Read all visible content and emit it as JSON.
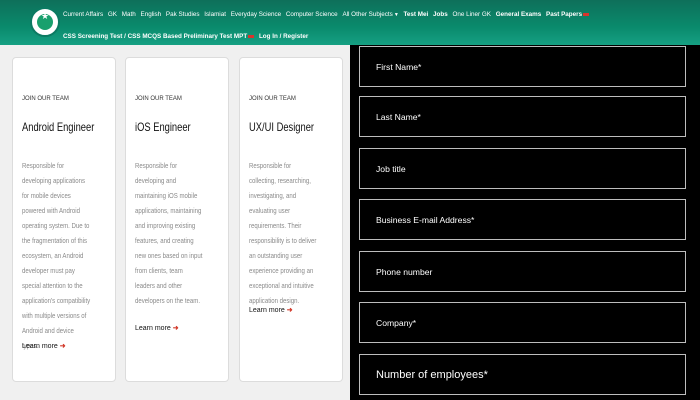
{
  "nav": {
    "row1": [
      "Current Affairs",
      "GK",
      "Math",
      "English",
      "Pak Studies",
      "Islamiat",
      "Everyday Science",
      "Computer Science",
      "All Other Subjects"
    ],
    "row1_bold": [
      "Test Mei",
      "Jobs"
    ],
    "row1_tail": [
      "One Liner GK"
    ],
    "row1_bold2": [
      "General Exams",
      "Past Papers"
    ],
    "row2": [
      "CSS Screening Test / CSS MCQS Based Preliminary Test MPT",
      "Log In / Register"
    ]
  },
  "cards": [
    {
      "kicker": "JOIN OUR TEAM",
      "title": "Android Engineer",
      "desc": "Responsible for developing applications for mobile devices powered with Android operating system. Due to the fragmentation of this ecosystem, an Android developer must pay special attention to the application's compatibility with multiple versions of Android and device types.",
      "learn": "Learn more"
    },
    {
      "kicker": "JOIN OUR TEAM",
      "title": "iOS Engineer",
      "desc": "Responsible for developing and maintaining iOS mobile applications, maintaining and improving existing features, and creating new ones based on input from clients, team leaders and other developers on the team.",
      "learn": "Learn more"
    },
    {
      "kicker": "JOIN OUR TEAM",
      "title": "UX/UI Designer",
      "desc": "Responsible for collecting, researching, investigating, and evaluating user requirements. Their responsibility is to deliver an outstanding user experience providing an exceptional and intuitive application design.",
      "learn": "Learn more"
    }
  ],
  "form": {
    "fields": [
      "First Name*",
      "Last Name*",
      "Job title",
      "Business E-mail Address*",
      "Phone number",
      "Company*",
      "Number of employees*"
    ]
  },
  "colors": {
    "header": "#0a8a6c",
    "accent_arrow": "#d23a2b",
    "form_bg": "#000000"
  }
}
